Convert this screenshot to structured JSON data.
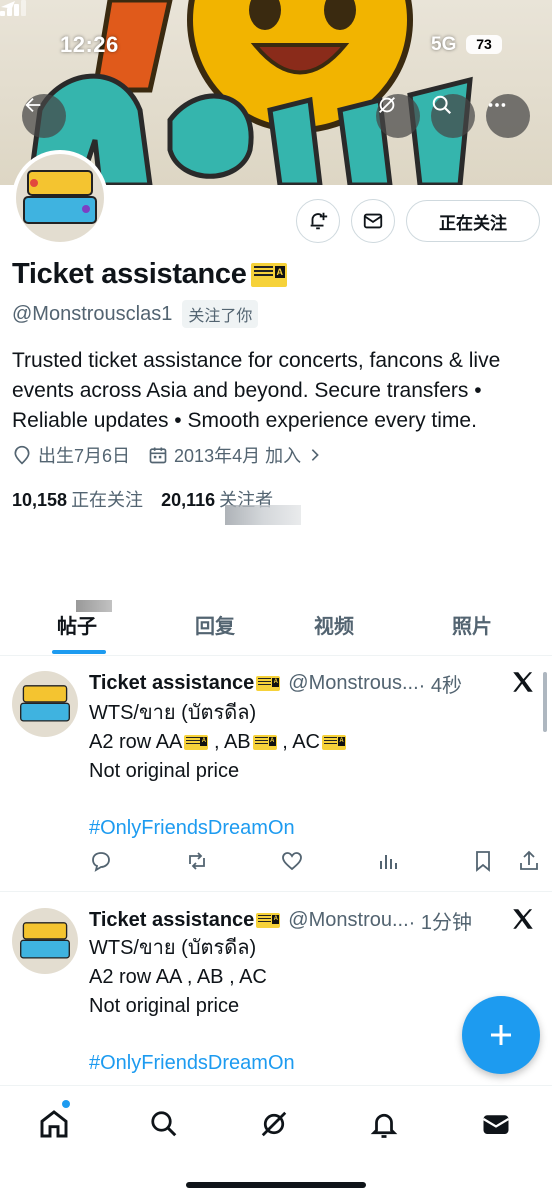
{
  "status_bar": {
    "time": "12:26",
    "network": "5G",
    "battery": "73"
  },
  "profile": {
    "display_name": "Ticket assistance",
    "handle": "@Monstrousclas1",
    "follows_you_label": "关注了你",
    "following_button_label": "正在关注",
    "bio": "Trusted ticket assistance for concerts, fancons & live events across Asia and beyond. Secure transfers • Reliable updates • Smooth experience every time.",
    "birthday": "出生7月6日",
    "joined": "2013年4月 加入",
    "following_count": "10,158",
    "following_label": "正在关注",
    "followers_count": "20,116",
    "followers_label": "关注者"
  },
  "tabs": [
    {
      "label": "帖子",
      "active": true
    },
    {
      "label": "回复",
      "active": false
    },
    {
      "label": "视频",
      "active": false
    },
    {
      "label": "照片",
      "active": false
    }
  ],
  "posts": [
    {
      "name": "Ticket assistance",
      "handle": "@Monstrous...",
      "time": "· 4秒",
      "line1": "WTS/ขาย (บัตรดีล)",
      "line2_a": "A2 row AA",
      "line2_b": " , AB",
      "line2_c": " , AC",
      "line3": "Not original price",
      "hashtag": "#OnlyFriendsDreamOn"
    },
    {
      "name": "Ticket assistance",
      "handle": "@Monstrou...",
      "time": "· 1分钟",
      "line1": "WTS/ขาย (บัตรดีล)",
      "line2": "A2 row AA , AB , AC",
      "line3": "Not original price",
      "hashtag": "#OnlyFriendsDreamOn"
    }
  ],
  "colors": {
    "accent": "#1d9bf0",
    "text": "#0f1419",
    "secondary": "#536471"
  },
  "icons": [
    "back-arrow-icon",
    "grok-icon",
    "search-icon",
    "more-icon",
    "notification-bell-plus-icon",
    "mail-icon",
    "location-pin-icon",
    "calendar-icon",
    "chevron-right-icon",
    "x-logo-icon",
    "reply-icon",
    "repost-icon",
    "like-icon",
    "views-icon",
    "bookmark-icon",
    "share-icon",
    "compose-plus-icon",
    "home-icon",
    "bell-icon",
    "messages-icon"
  ]
}
